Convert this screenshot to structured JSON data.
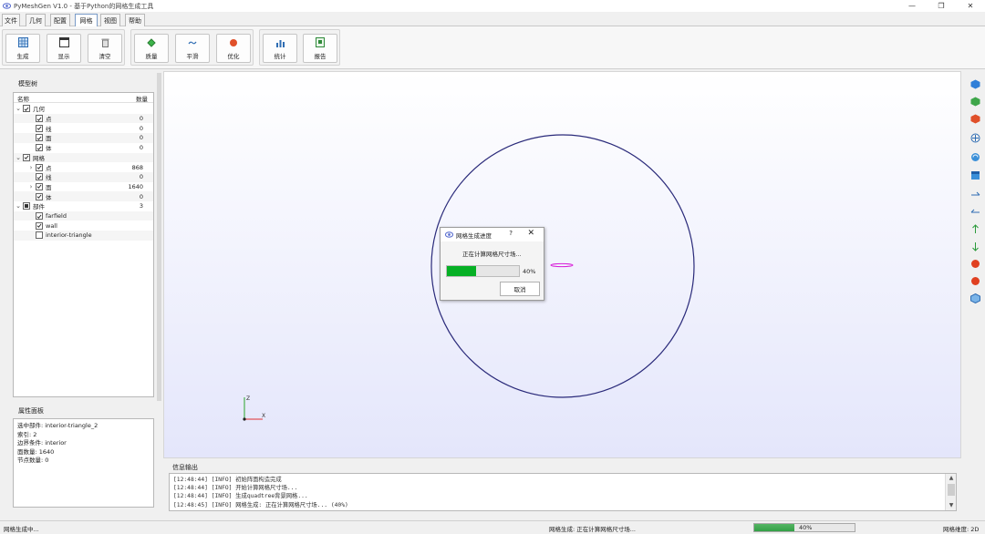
{
  "window": {
    "title": "PyMeshGen V1.0 - 基于Python的网格生成工具",
    "controls": [
      "—",
      "❐",
      "✕"
    ]
  },
  "menu": {
    "tabs": [
      {
        "label": "文件",
        "active": false
      },
      {
        "label": "几何",
        "active": false
      },
      {
        "label": "配置",
        "active": false
      },
      {
        "label": "网格",
        "active": true
      },
      {
        "label": "视图",
        "active": false
      },
      {
        "label": "帮助",
        "active": false
      }
    ]
  },
  "toolbar": {
    "buttons": [
      {
        "label": "生成",
        "icon": "grid-icon"
      },
      {
        "label": "显示",
        "icon": "window-icon"
      },
      {
        "label": "清空",
        "icon": "trash-icon"
      },
      {
        "label": "质量",
        "icon": "diamond-icon"
      },
      {
        "label": "平滑",
        "icon": "smooth-icon"
      },
      {
        "label": "优化",
        "icon": "dot-icon"
      },
      {
        "label": "统计",
        "icon": "bar-chart-icon"
      },
      {
        "label": "报告",
        "icon": "report-icon"
      }
    ]
  },
  "model_tree": {
    "title": "模型树",
    "col_name": "名称",
    "col_count": "数量",
    "rows": [
      {
        "label": "几何",
        "count": "",
        "level": 0,
        "arrow": "v",
        "check": "checked"
      },
      {
        "label": "点",
        "count": "0",
        "level": 1,
        "arrow": "",
        "check": "checked"
      },
      {
        "label": "线",
        "count": "0",
        "level": 1,
        "arrow": "",
        "check": "checked"
      },
      {
        "label": "面",
        "count": "0",
        "level": 1,
        "arrow": "",
        "check": "checked"
      },
      {
        "label": "体",
        "count": "0",
        "level": 1,
        "arrow": "",
        "check": "checked"
      },
      {
        "label": "网格",
        "count": "",
        "level": 0,
        "arrow": "v",
        "check": "checked"
      },
      {
        "label": "点",
        "count": "868",
        "level": 1,
        "arrow": ">",
        "check": "checked"
      },
      {
        "label": "线",
        "count": "0",
        "level": 1,
        "arrow": "",
        "check": "checked"
      },
      {
        "label": "面",
        "count": "1640",
        "level": 1,
        "arrow": ">",
        "check": "checked"
      },
      {
        "label": "体",
        "count": "0",
        "level": 1,
        "arrow": "",
        "check": "checked"
      },
      {
        "label": "部件",
        "count": "3",
        "level": 0,
        "arrow": "v",
        "check": "partial"
      },
      {
        "label": "farfield",
        "count": "",
        "level": 1,
        "arrow": "",
        "check": "checked"
      },
      {
        "label": "wall",
        "count": "",
        "level": 1,
        "arrow": "",
        "check": "checked"
      },
      {
        "label": "interior-triangle",
        "count": "",
        "level": 1,
        "arrow": "",
        "check": "unchecked"
      }
    ]
  },
  "properties": {
    "title": "属性面板",
    "lines": [
      "选中部件: interior-triangle_2",
      "索引: 2",
      "边界条件: interior",
      "面数量: 1640",
      "节点数量: 0"
    ]
  },
  "progress_dialog": {
    "title": "网格生成进度",
    "help": "?",
    "close": "✕",
    "message": "正在计算网格尺寸场...",
    "percent_text": "40%",
    "progress": 0.4,
    "cancel_label": "取消"
  },
  "axes": {
    "z": "Z",
    "x": "X"
  },
  "log": {
    "title": "信息输出",
    "lines": [
      "[12:48:44] [INFO] 初始阵面构造完成",
      "[12:48:44] [INFO] 开始计算网格尺寸场...",
      "[12:48:44] [INFO] 生成quadtree背景网格...",
      "[12:48:45] [INFO] 网格生成: 正在计算网格尺寸场... (40%)"
    ]
  },
  "status": {
    "left": "网格生成中...",
    "middle": "网格生成: 正在计算网格尺寸场...",
    "percent_text": "40%",
    "progress": 0.4,
    "right": "网格维度: 2D"
  },
  "colors": {
    "mesh_circle": "#2a2a7a",
    "wall_ellipse": "#d81fd8",
    "progress_green": "#06b025"
  }
}
